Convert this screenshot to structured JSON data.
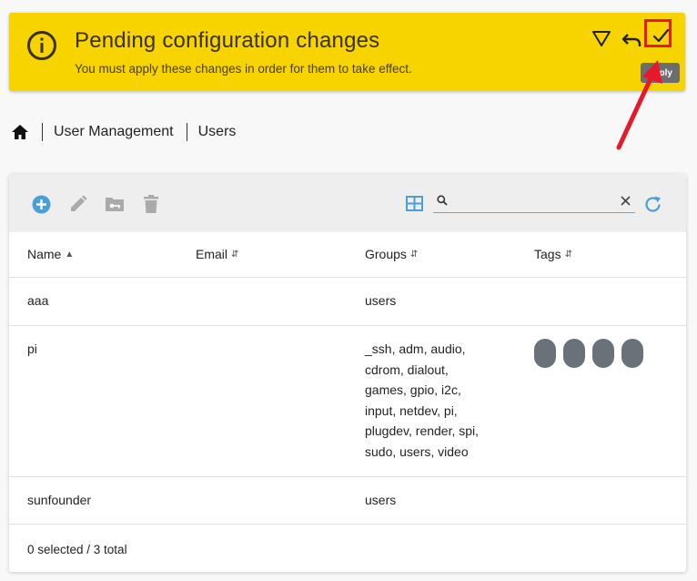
{
  "banner": {
    "title": "Pending configuration changes",
    "subtitle": "You must apply these changes in order for them to take effect.",
    "tooltip": "ply",
    "color": "#f7d300"
  },
  "breadcrumb": {
    "home_icon": "home-icon",
    "items": [
      "User Management",
      "Users"
    ]
  },
  "toolbar": {
    "icons": [
      "add-icon",
      "edit-icon",
      "key-folder-icon",
      "delete-icon",
      "table-view-icon",
      "search-icon",
      "clear-icon",
      "refresh-icon"
    ],
    "search_value": ""
  },
  "table": {
    "columns": [
      "Name",
      "Email",
      "Groups",
      "Tags"
    ],
    "rows": [
      {
        "name": "aaa",
        "email": "",
        "groups": [
          "users"
        ],
        "tags": 0
      },
      {
        "name": "pi",
        "email": "",
        "groups": [
          "_ssh, adm, audio,",
          "cdrom, dialout,",
          "games, gpio, i2c,",
          "input, netdev, pi,",
          "plugdev, render, spi,",
          "sudo, users, video"
        ],
        "tags": 4
      },
      {
        "name": "sunfounder",
        "email": "",
        "groups": [
          "users"
        ],
        "tags": 0
      }
    ],
    "footer": "0 selected / 3 total"
  },
  "colors": {
    "accent": "#4a9fd8",
    "highlight": "#e6192b",
    "tag": "#6b7178"
  }
}
